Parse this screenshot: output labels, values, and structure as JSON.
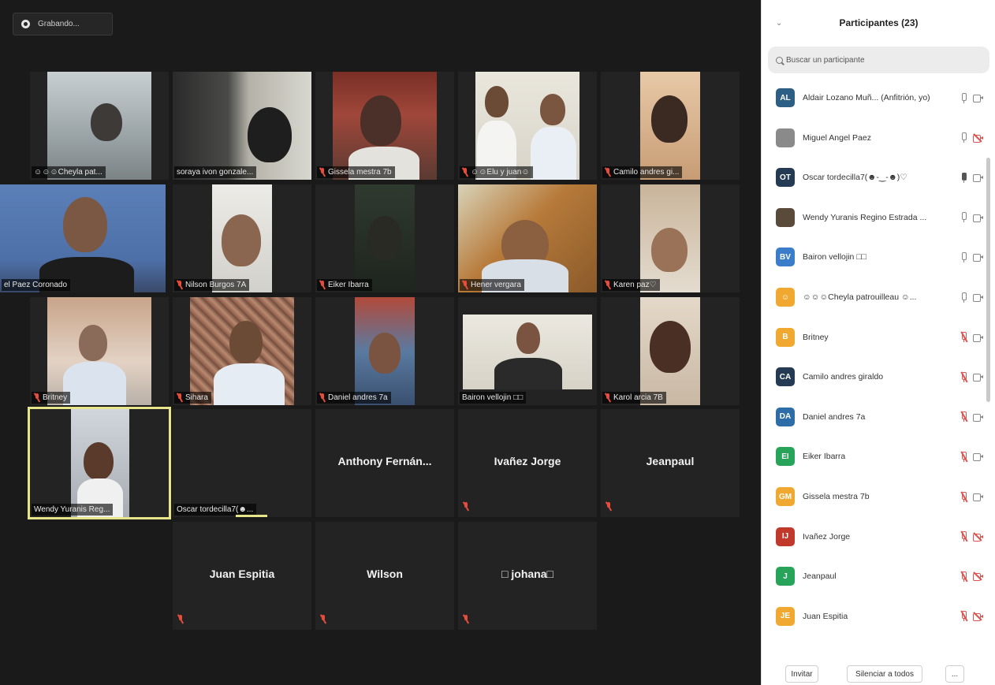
{
  "recording": {
    "label": "Grabando..."
  },
  "gallery": {
    "tiles": [
      {
        "name": "☺☺☺Cheyla pat...",
        "muted": false
      },
      {
        "name": "soraya ivon gonzale...",
        "muted": false
      },
      {
        "name": "Gissela mestra 7b",
        "muted": true
      },
      {
        "name": "☺☺Elu y juan☺",
        "muted": true
      },
      {
        "name": "Camilo andres gi...",
        "muted": true
      },
      {
        "name": "el Paez Coronado",
        "muted": false
      },
      {
        "name": "Nilson Burgos 7A",
        "muted": true
      },
      {
        "name": "Eiker Ibarra",
        "muted": true
      },
      {
        "name": "Hener vergara",
        "muted": true
      },
      {
        "name": "Karen paz♡",
        "muted": true
      },
      {
        "name": "Britney",
        "muted": true
      },
      {
        "name": "Sihara",
        "muted": true
      },
      {
        "name": "Daniel andres 7a",
        "muted": true
      },
      {
        "name": "Bairon vellojin □□",
        "muted": false
      },
      {
        "name": "Karol arcia 7B",
        "muted": true
      },
      {
        "name": "Wendy Yuranis Reg...",
        "muted": false
      },
      {
        "name": "Oscar tordecilla7(☻...",
        "muted": false
      },
      {
        "name": "Anthony  Fernán...",
        "muted": false
      },
      {
        "name": "Ivañez Jorge",
        "muted": true
      },
      {
        "name": "Jeanpaul",
        "muted": true
      },
      {
        "name": "Juan Espitia",
        "muted": true
      },
      {
        "name": "Wilson",
        "muted": true
      },
      {
        "name": "□ johana□",
        "muted": true
      }
    ]
  },
  "panel": {
    "title": "Participantes (23)",
    "search_placeholder": "Buscar un participante",
    "participants": [
      {
        "initials": "AL",
        "color": "#2d5e84",
        "name": "Aldair Lozano Muñ... (Anfitrión, yo)",
        "mic": "on",
        "cam": "on"
      },
      {
        "initials": "",
        "color": "#8a8a8a",
        "name": "Miguel Angel Paez",
        "mic": "on",
        "cam": "off"
      },
      {
        "initials": "OT",
        "color": "#243b53",
        "name": "Oscar tordecilla7(☻-‿-☻)♡",
        "mic": "dark",
        "cam": "on"
      },
      {
        "initials": "",
        "color": "#5a4a3a",
        "name": "Wendy Yuranis Regino Estrada ...",
        "mic": "on",
        "cam": "on"
      },
      {
        "initials": "BV",
        "color": "#3a7dc9",
        "name": "Bairon vellojin □□",
        "mic": "on",
        "cam": "on"
      },
      {
        "initials": "☺",
        "color": "#f0a830",
        "name": "☺☺☺Cheyla patrouilleau ☺...",
        "mic": "on",
        "cam": "on"
      },
      {
        "initials": "B",
        "color": "#f0a830",
        "name": "Britney",
        "mic": "off",
        "cam": "on"
      },
      {
        "initials": "CA",
        "color": "#243b53",
        "name": "Camilo andres giraldo",
        "mic": "off",
        "cam": "on"
      },
      {
        "initials": "DA",
        "color": "#2d6ea8",
        "name": "Daniel andres 7a",
        "mic": "off",
        "cam": "on"
      },
      {
        "initials": "EI",
        "color": "#27a35a",
        "name": "Eiker Ibarra",
        "mic": "off",
        "cam": "on"
      },
      {
        "initials": "GM",
        "color": "#f0a830",
        "name": "Gissela mestra 7b",
        "mic": "off",
        "cam": "on"
      },
      {
        "initials": "IJ",
        "color": "#c0392b",
        "name": "Ivañez Jorge",
        "mic": "off",
        "cam": "off"
      },
      {
        "initials": "J",
        "color": "#27a35a",
        "name": "Jeanpaul",
        "mic": "off",
        "cam": "off"
      },
      {
        "initials": "JE",
        "color": "#f0a830",
        "name": "Juan Espitia",
        "mic": "off",
        "cam": "off"
      }
    ],
    "footer": {
      "invite": "Invitar",
      "mute_all": "Silenciar a todos",
      "more": "..."
    }
  }
}
